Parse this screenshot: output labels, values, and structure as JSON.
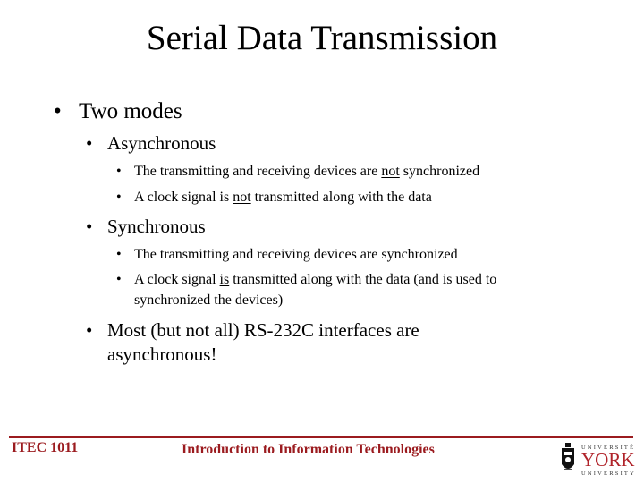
{
  "slide": {
    "title": "Serial Data Transmission",
    "bullets": {
      "main": "Two modes",
      "async": {
        "label": "Asynchronous",
        "items": [
          {
            "pre": "The transmitting and receiving devices are ",
            "u": "not",
            "post": " synchronized"
          },
          {
            "pre": "A clock signal is ",
            "u": "not",
            "post": " transmitted along with the data"
          }
        ]
      },
      "sync": {
        "label": "Synchronous",
        "items": [
          {
            "pre": "The transmitting and receiving devices are synchronized",
            "u": "",
            "post": ""
          },
          {
            "pre": "A clock signal ",
            "u": "is",
            "post": " transmitted along with the data (and is used to",
            "cont": "synchronized the devices)"
          }
        ]
      },
      "note": {
        "line1": "Most (but not all) RS-232C interfaces are",
        "line2": "asynchronous!"
      }
    },
    "bullet_char": "•"
  },
  "footer": {
    "course": "ITEC 1011",
    "course_title": "Introduction to Information Technologies",
    "logo": {
      "icon": "york-crest-icon",
      "top": "UNIVERSITÉ",
      "name": "YORK",
      "bottom": "UNIVERSITY"
    },
    "accent_color": "#9b1b1f"
  }
}
